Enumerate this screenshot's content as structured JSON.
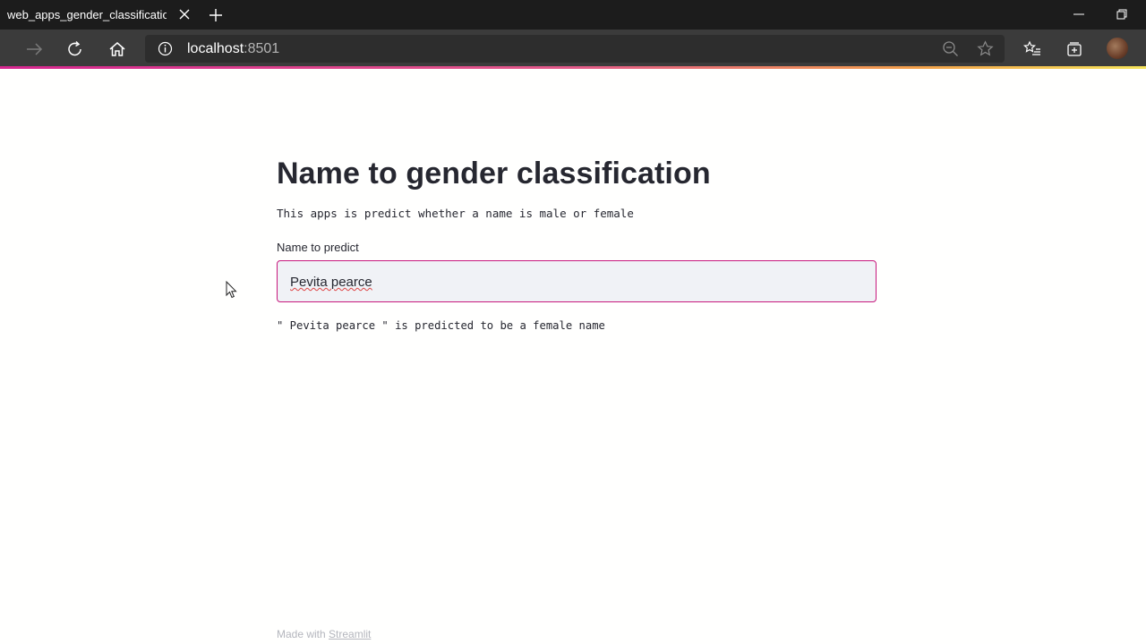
{
  "browser": {
    "tab_title": "web_apps_gender_classification",
    "url_host": "localhost",
    "url_port": ":8501",
    "icons": [
      "close-icon",
      "plus-icon",
      "minimize-icon",
      "restore-icon",
      "forward-icon",
      "reload-icon",
      "home-icon",
      "info-icon",
      "zoom-icon",
      "star-icon",
      "favorites-icon",
      "collections-icon",
      "avatar"
    ]
  },
  "app": {
    "title": "Name to gender classification",
    "subtitle": "This apps is predict whether a name is male or female",
    "input_label": "Name to predict",
    "input_value": "Pevita pearce",
    "result_text": "\" Pevita pearce \" is predicted to be a female name",
    "footer_prefix": "Made with ",
    "footer_link": "Streamlit"
  },
  "colors": {
    "accent": "#c7187d",
    "text": "#262730",
    "input_bg": "#f0f2f6",
    "chrome_dark": "#1c1c1c",
    "chrome_toolbar": "#3b3b3b"
  }
}
